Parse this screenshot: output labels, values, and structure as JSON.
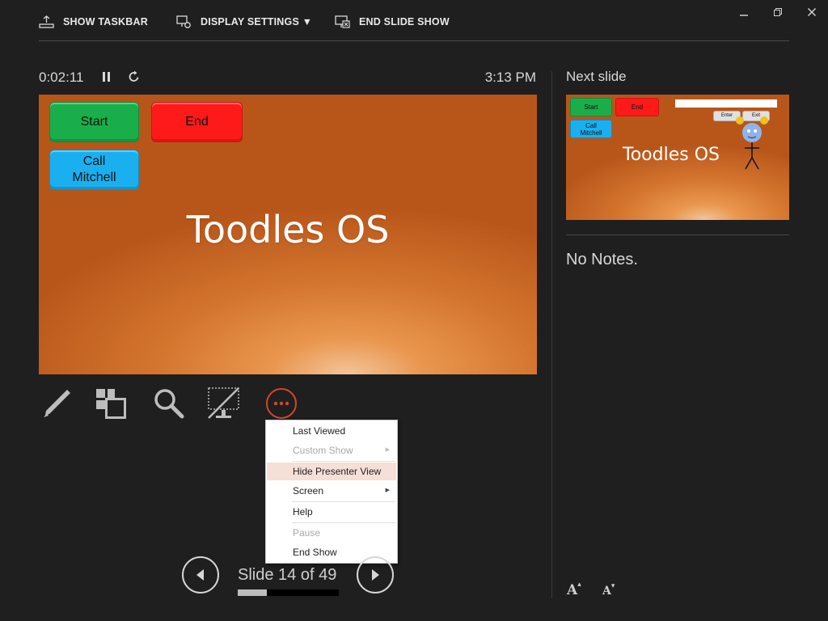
{
  "window_controls": {
    "minimize": "—",
    "restore": "❐",
    "close": "✕"
  },
  "toolbar": {
    "show_taskbar": "SHOW TASKBAR",
    "display_settings": "DISPLAY SETTINGS ▼",
    "end_slide_show": "END SLIDE SHOW"
  },
  "timer": {
    "elapsed": "0:02:11",
    "clock": "3:13 PM"
  },
  "slide": {
    "title": "Toodles OS",
    "buttons": {
      "start": "Start",
      "end": "End",
      "call": "Call Mitchell"
    },
    "colors": {
      "start": "#1aae4a",
      "end": "#ff1a1a",
      "call": "#1ab0f0"
    }
  },
  "tools": [
    "pen-icon",
    "slide-sorter-icon",
    "zoom-icon",
    "black-screen-icon",
    "more-options-icon"
  ],
  "menu": {
    "items": [
      {
        "label": "Last Viewed",
        "disabled": false
      },
      {
        "label": "Custom Show",
        "disabled": true,
        "submenu": true
      },
      {
        "label": "Hide Presenter View",
        "disabled": false,
        "highlighted": true
      },
      {
        "label": "Screen",
        "disabled": false,
        "submenu": true
      },
      {
        "label": "Help",
        "disabled": false
      },
      {
        "label": "Pause",
        "disabled": true
      },
      {
        "label": "End Show",
        "disabled": false
      }
    ]
  },
  "navigation": {
    "slide_count": "Slide 14 of 49",
    "current": 14,
    "total": 49,
    "progress_fraction": 0.286
  },
  "next_slide": {
    "label": "Next slide",
    "title": "Toodles OS",
    "buttons": {
      "start": "Start",
      "end": "End",
      "call": "Call Mitchell",
      "enter": "Enter",
      "exit": "Exit"
    }
  },
  "notes": {
    "text": "No Notes."
  },
  "font_controls": {
    "increase": "A",
    "decrease": "A"
  }
}
